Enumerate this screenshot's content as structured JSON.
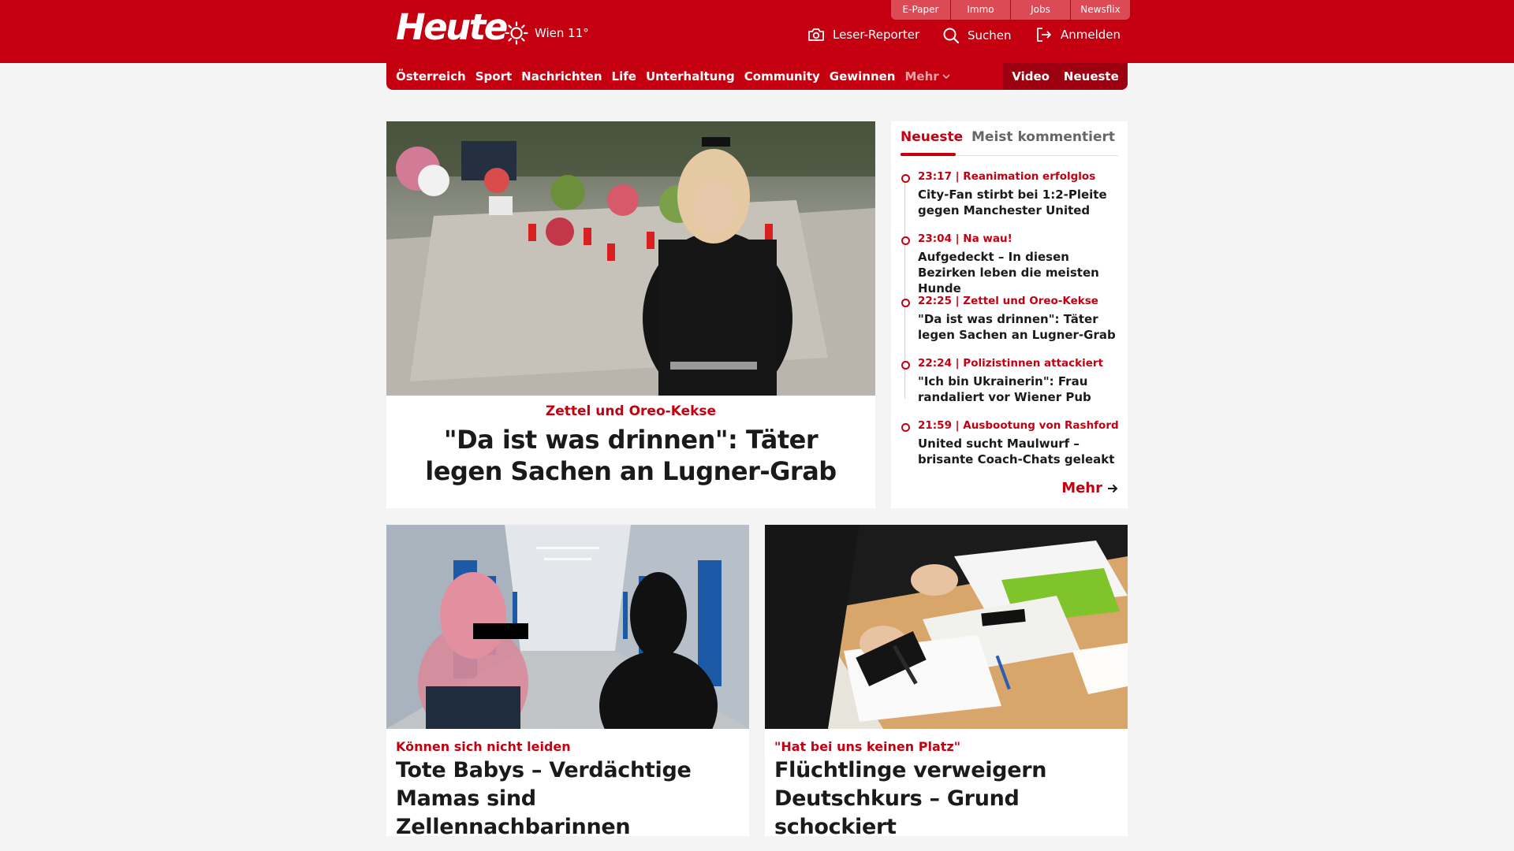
{
  "header": {
    "logo": "Heute",
    "weather": {
      "location_temp": "Wien 11°",
      "icon": "sun-icon"
    },
    "service_links": [
      "E-Paper",
      "Immo",
      "Jobs",
      "Newsflix"
    ],
    "actions": {
      "reporter": "Leser-Reporter",
      "search": "Suchen",
      "login": "Anmelden"
    }
  },
  "nav": {
    "items": [
      "Österreich",
      "Sport",
      "Nachrichten",
      "Life",
      "Unterhaltung",
      "Community",
      "Gewinnen"
    ],
    "more": "Mehr",
    "right": [
      "Video",
      "Neueste"
    ]
  },
  "hero": {
    "kicker": "Zettel und Oreo-Kekse",
    "title": "\"Da ist was drinnen\": Täter legen Sachen an Lugner-Grab"
  },
  "sidebar": {
    "tabs": [
      "Neueste",
      "Meist kommentiert"
    ],
    "items": [
      {
        "meta": "23:17 | Reanimation erfolglos",
        "title": "City-Fan stirbt bei 1:2-Pleite gegen Manchester United"
      },
      {
        "meta": "23:04 | Na wau!",
        "title": "Aufgedeckt – In diesen Bezirken leben die meisten Hunde"
      },
      {
        "meta": "22:25 | Zettel und Oreo-Kekse",
        "title": "\"Da ist was drinnen\": Täter legen Sachen an Lugner-Grab"
      },
      {
        "meta": "22:24 | Polizistinnen attackiert",
        "title": "\"Ich bin Ukrainerin\": Frau randaliert vor Wiener Pub"
      },
      {
        "meta": "21:59 | Ausbootung von Rashford",
        "title": "United sucht Maulwurf – brisante Coach-Chats geleakt"
      }
    ],
    "more": "Mehr"
  },
  "cards": [
    {
      "kicker": "Können sich nicht leiden",
      "title": "Tote Babys – Verdächtige Mamas sind Zellennachbarinnen"
    },
    {
      "kicker": "\"Hat bei uns keinen Platz\"",
      "title": "Flüchtlinge verweigern Deutschkurs – Grund schockiert"
    }
  ],
  "colors": {
    "brand_red": "#c40010",
    "dark_red": "#9c0010",
    "service_link": "#dc4b55",
    "background": "#f4f4f4"
  }
}
